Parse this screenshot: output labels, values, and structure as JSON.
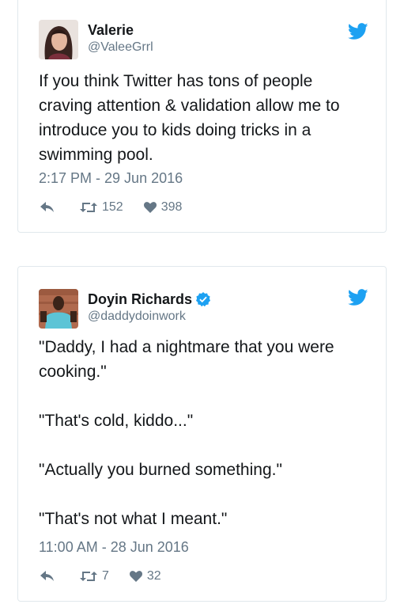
{
  "tweets": [
    {
      "display_name": "Valerie",
      "handle": "@ValeeGrrl",
      "verified": false,
      "text": "If you think Twitter has tons of people craving attention & validation allow me to introduce you to kids doing tricks in a swimming pool.",
      "timestamp": "2:17 PM - 29 Jun 2016",
      "retweets": "152",
      "likes": "398"
    },
    {
      "display_name": "Doyin Richards",
      "handle": "@daddydoinwork",
      "verified": true,
      "text": "\"Daddy, I had a nightmare that you were cooking.\"\n\n\"That's cold, kiddo...\"\n\n\"Actually you burned something.\"\n\n\"That's not what I meant.\"",
      "timestamp": "11:00 AM - 28 Jun 2016",
      "retweets": "7",
      "likes": "32"
    }
  ],
  "colors": {
    "twitter_blue": "#1da1f2",
    "text": "#14171a",
    "secondary_text": "#657786",
    "border": "#e1e8ed"
  },
  "icons": [
    "twitter-bird-icon",
    "verified-badge-icon",
    "reply-icon",
    "retweet-icon",
    "like-heart-icon"
  ]
}
